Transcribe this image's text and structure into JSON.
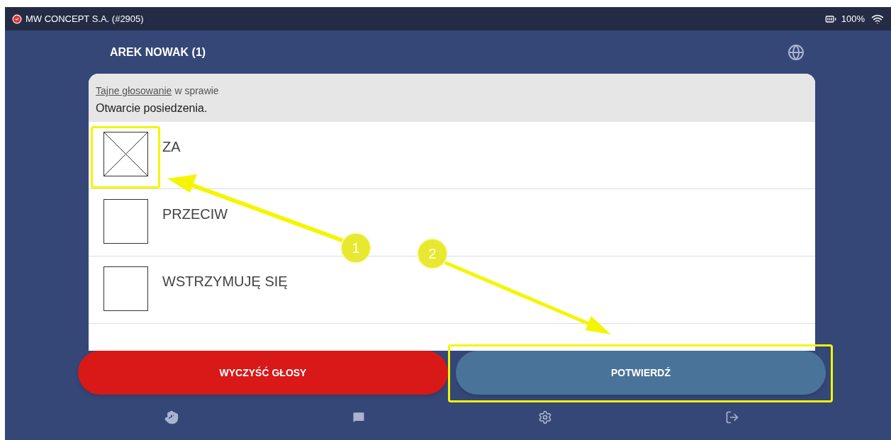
{
  "status_bar": {
    "company": "MW CONCEPT S.A. (#2905)",
    "connected": true,
    "battery": "100%"
  },
  "header": {
    "user": "AREK NOWAK (1)"
  },
  "ballot": {
    "link": "Tajne głosowanie",
    "intro": "w sprawie",
    "subject": "Otwarcie posiedzenia.",
    "options": [
      {
        "label": "ZA",
        "checked": true
      },
      {
        "label": "PRZECIW",
        "checked": false
      },
      {
        "label": "WSTRZYMUJĘ SIĘ",
        "checked": false
      }
    ]
  },
  "buttons": [
    {
      "label": "WYCZYŚĆ GŁOSY",
      "kind": "clear"
    },
    {
      "label": "POTWIERDŹ",
      "kind": "confirm"
    }
  ],
  "annotations": [
    {
      "label": "1"
    },
    {
      "label": "2"
    }
  ]
}
